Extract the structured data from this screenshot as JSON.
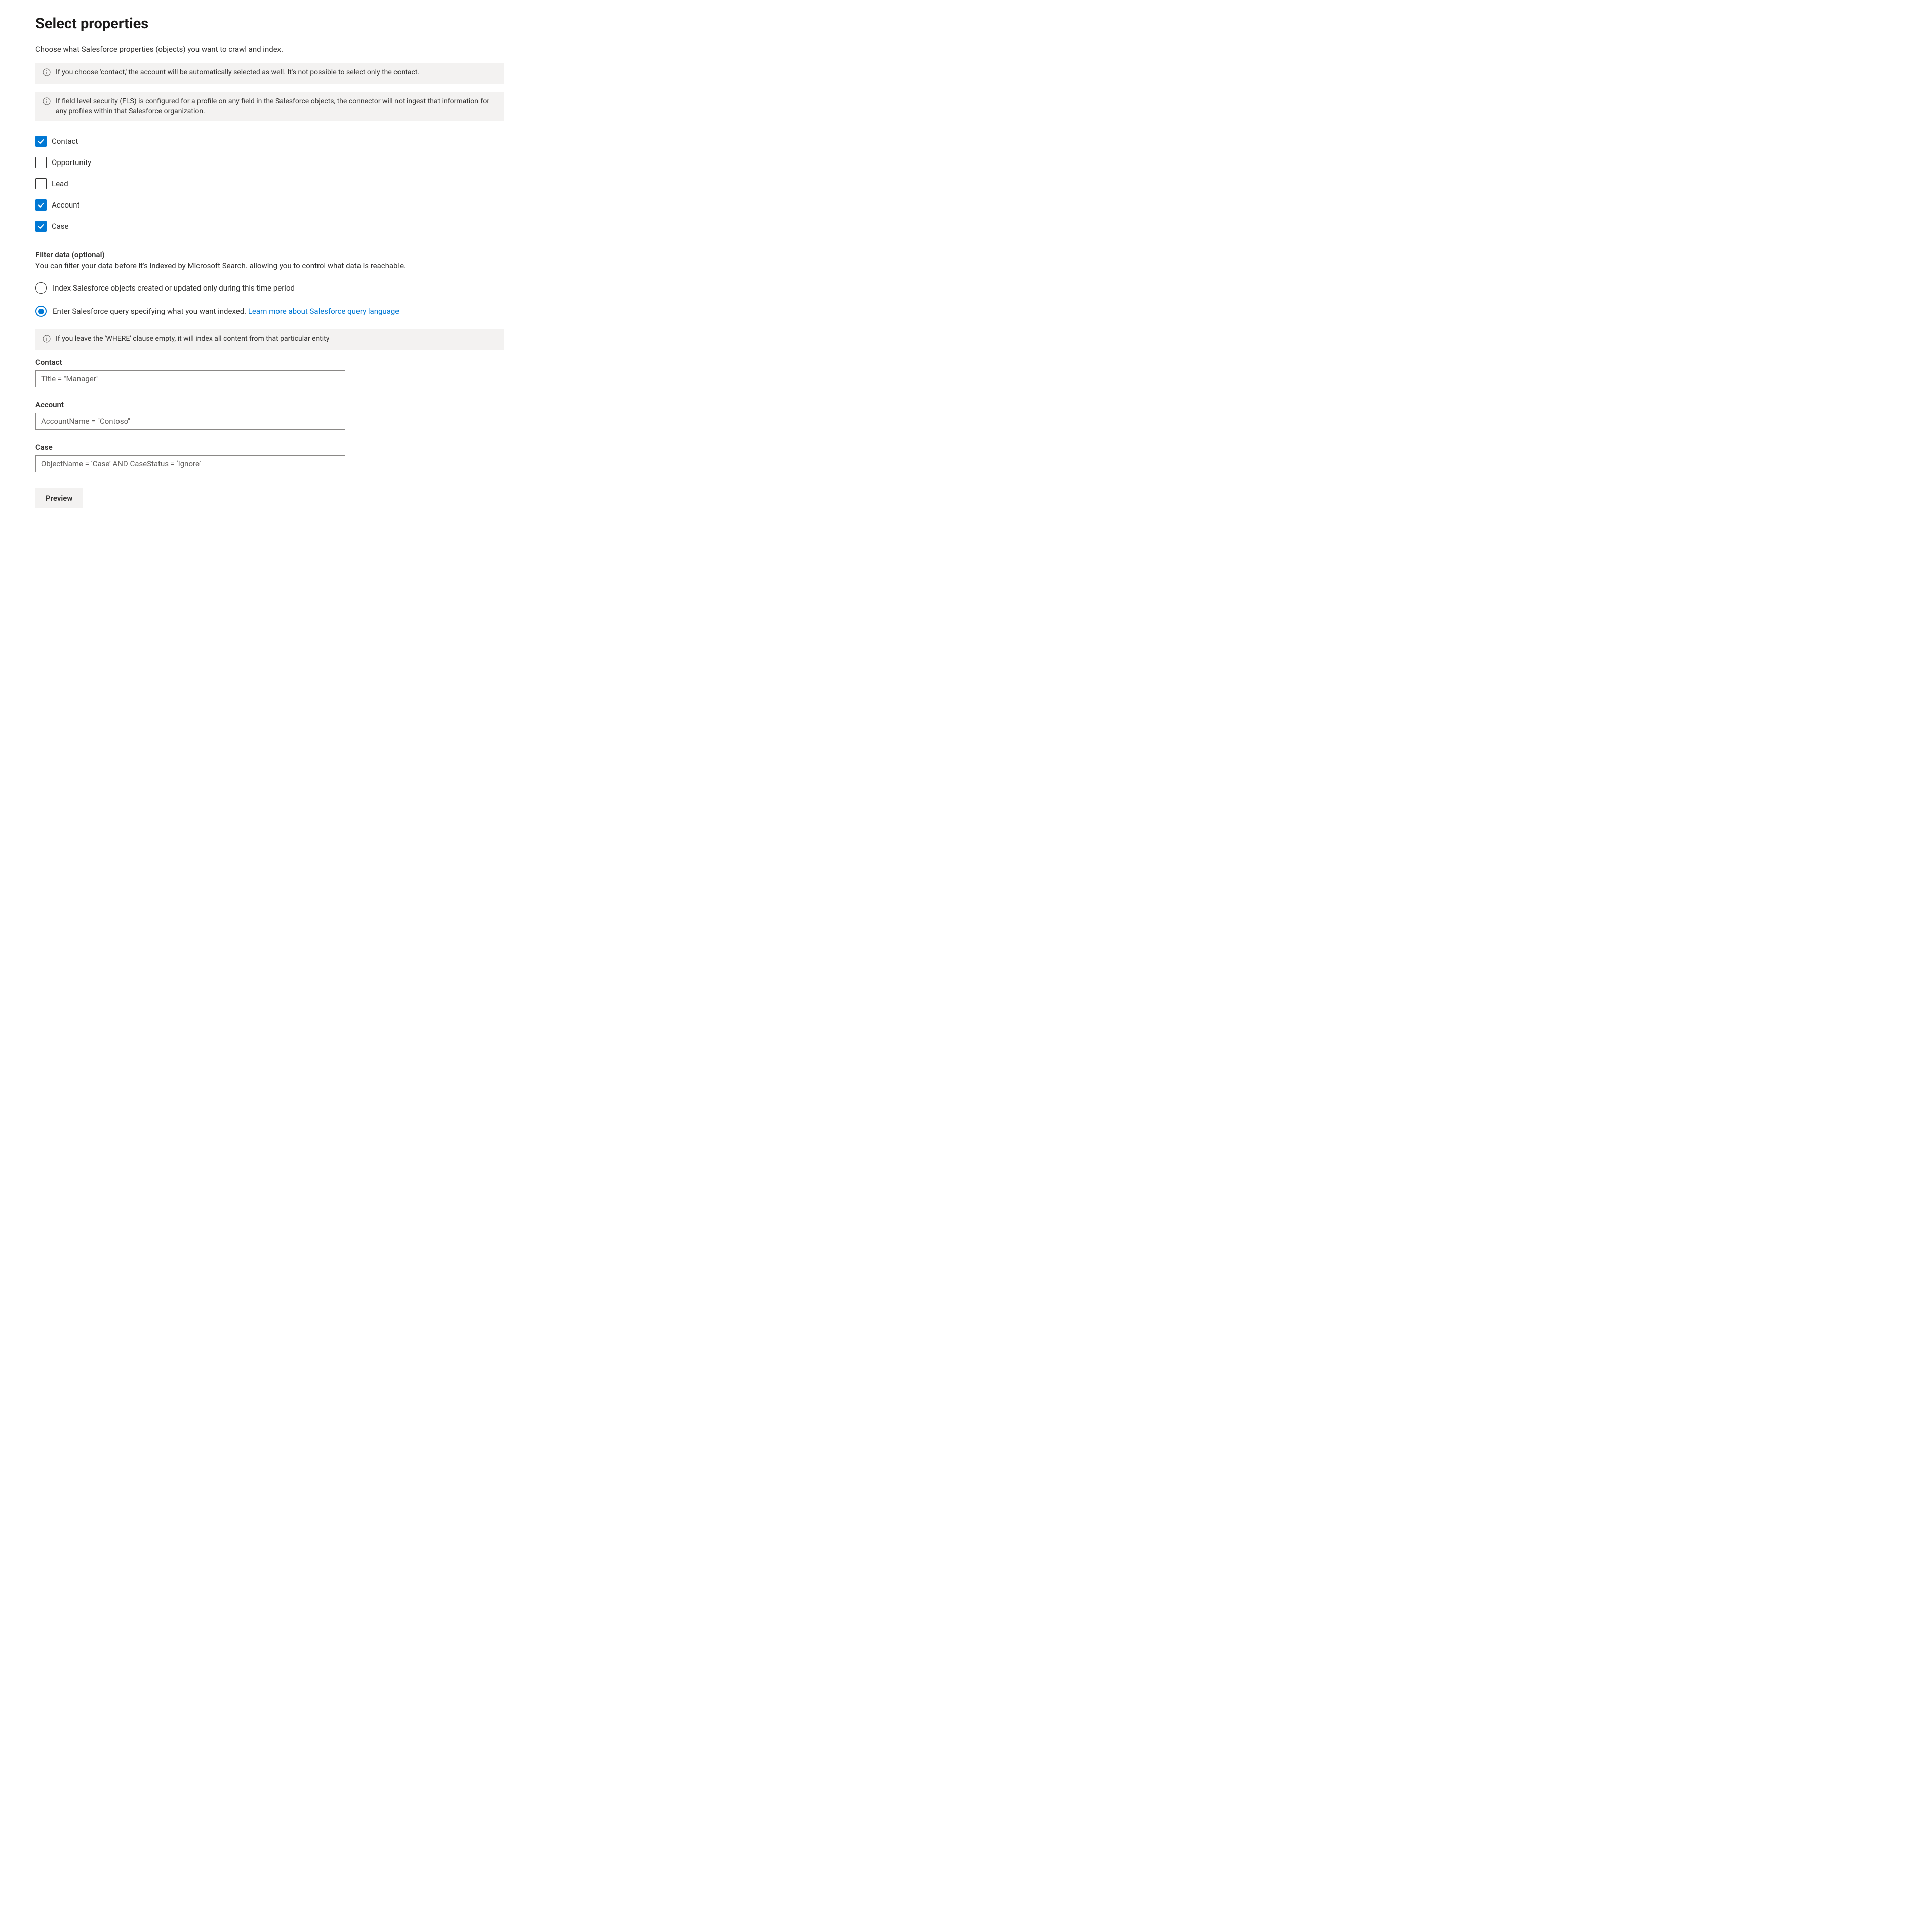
{
  "header": {
    "title": "Select properties",
    "intro": "Choose what Salesforce properties (objects) you want to crawl and index."
  },
  "infoBars": {
    "contactNote": "If you choose 'contact,' the account will be automatically selected as well. It's not possible to select only the contact.",
    "flsNote": "If field level security (FLS) is configured for a profile on any field in the Salesforce objects, the connector will not ingest that information for any profiles within that Salesforce organization.",
    "whereNote": "If you leave the 'WHERE' clause empty, it will index all content from that particular entity"
  },
  "checkboxes": [
    {
      "label": "Contact",
      "checked": true
    },
    {
      "label": "Opportunity",
      "checked": false
    },
    {
      "label": "Lead",
      "checked": false
    },
    {
      "label": "Account",
      "checked": true
    },
    {
      "label": "Case",
      "checked": true
    }
  ],
  "filterSection": {
    "heading": "Filter data (optional)",
    "description": "You can filter your data before it's indexed by Microsoft Search. allowing you to control what data is reachable."
  },
  "radios": {
    "timePeriod": {
      "label": "Index Salesforce objects created or updated only during this time period",
      "selected": false
    },
    "query": {
      "labelPrefix": "Enter Salesforce query specifying what you want indexed. ",
      "link": "Learn more about Salesforce query language",
      "selected": true
    }
  },
  "queryFields": {
    "contact": {
      "label": "Contact",
      "value": "Title = \"Manager\""
    },
    "account": {
      "label": "Account",
      "value": "AccountName = \"Contoso\""
    },
    "case": {
      "label": "Case",
      "value": "ObjectName = ‘Case’ AND CaseStatus = ‘Ignore’"
    }
  },
  "buttons": {
    "preview": "Preview"
  }
}
